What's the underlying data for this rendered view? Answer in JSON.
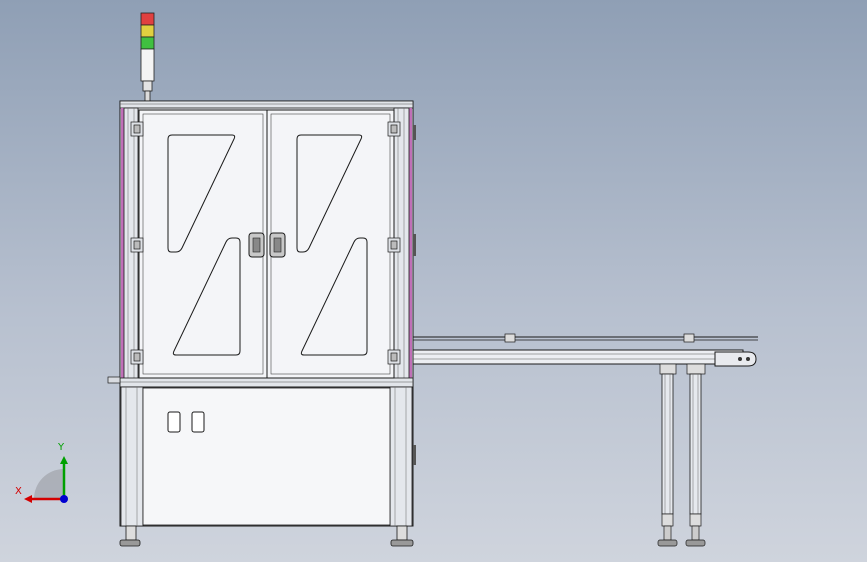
{
  "viewport": {
    "background_top": "#8f9fb5",
    "background_bottom": "#cfd4dd"
  },
  "triad": {
    "x_label": "X",
    "y_label": "Y",
    "x_color": "#d40000",
    "y_color": "#00a000",
    "z_color": "#0000d0"
  },
  "signal_tower": {
    "lights": [
      "#e04040",
      "#e0d040",
      "#40c040"
    ]
  },
  "colors": {
    "frame_fill": "#e6e9ee",
    "outline": "#1a1a1a",
    "panel_fill": "#f2f4f7",
    "accent_magenta": "#c070b8"
  }
}
